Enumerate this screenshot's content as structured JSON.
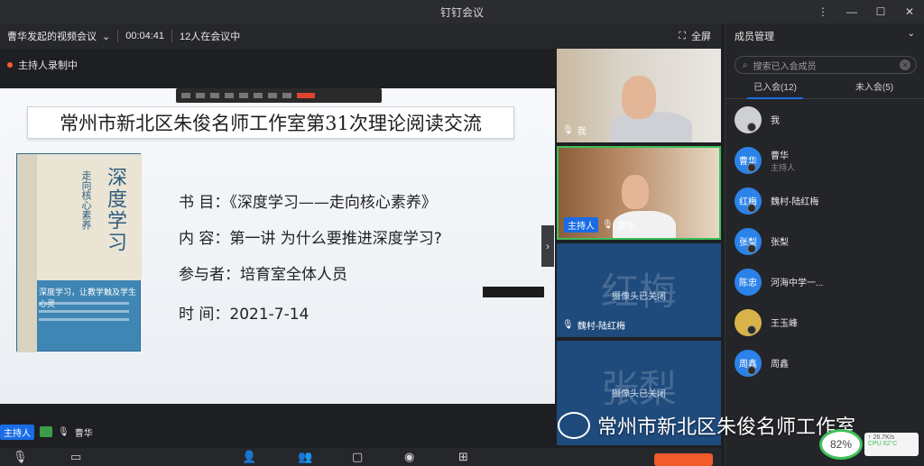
{
  "window": {
    "title": "钉钉会议",
    "controls": [
      "⋮",
      "—",
      "☐",
      "✕"
    ]
  },
  "topbar": {
    "meeting_title": "曹华发起的视频会议",
    "timer": "00:04:41",
    "count": "12人在会议中",
    "fullscreen_label": "全屏"
  },
  "recording": {
    "label": "主持人录制中"
  },
  "slide": {
    "title": "常州市新北区朱俊名师工作室第31次理论阅读交流",
    "book_title": "深度学习",
    "book_sub": "走向核心素养",
    "book_slogan": "深度学习，让教学触及学生心灵",
    "line1": "书  目：《深度学习——走向核心素养》",
    "line2": "内  容：第一讲  为什么要推进深度学习?",
    "line3": "参与者：培育室全体人员",
    "line4": "时  间：2021-7-14"
  },
  "host_bar": {
    "host_tag": "主持人",
    "name": "曹华"
  },
  "tiles": [
    {
      "name": "我"
    },
    {
      "host_tag": "主持人",
      "name": "曹华"
    },
    {
      "big": "红梅",
      "cam_off": "摄像头已关闭",
      "name": "魏村-陆红梅"
    },
    {
      "big": "张梨",
      "cam_off": "摄像头已关闭"
    }
  ],
  "sidebar": {
    "title": "成员管理",
    "search_placeholder": "搜索已入会成员",
    "tabs": [
      "已入会(12)",
      "未入会(5)"
    ],
    "members": [
      {
        "avatar": "",
        "name": "我",
        "sub": ""
      },
      {
        "avatar": "曹华",
        "name": "曹华",
        "sub": "主持人"
      },
      {
        "avatar": "红梅",
        "name": "魏村-陆红梅",
        "sub": ""
      },
      {
        "avatar": "张梨",
        "name": "张梨",
        "sub": ""
      },
      {
        "avatar": "陈忠",
        "name": "河海中学一...",
        "sub": ""
      },
      {
        "avatar": "",
        "name": "王玉峰",
        "sub": ""
      },
      {
        "avatar": "周鑫",
        "name": "周鑫",
        "sub": ""
      }
    ]
  },
  "watermark": {
    "text": "常州市新北区朱俊名师工作室"
  },
  "perf": {
    "percent": "82%",
    "net": "↑ 26.7K/s",
    "cpu": "CPU 62°C"
  },
  "icons": {
    "search": "search-icon",
    "mic": "mic-icon",
    "chevron": "chevron-down-icon"
  },
  "colors": {
    "accent": "#1a6ce6",
    "recording": "#ff5a2a",
    "active_speaker": "#3fbf5a",
    "slide_book": "#3f86b4"
  }
}
